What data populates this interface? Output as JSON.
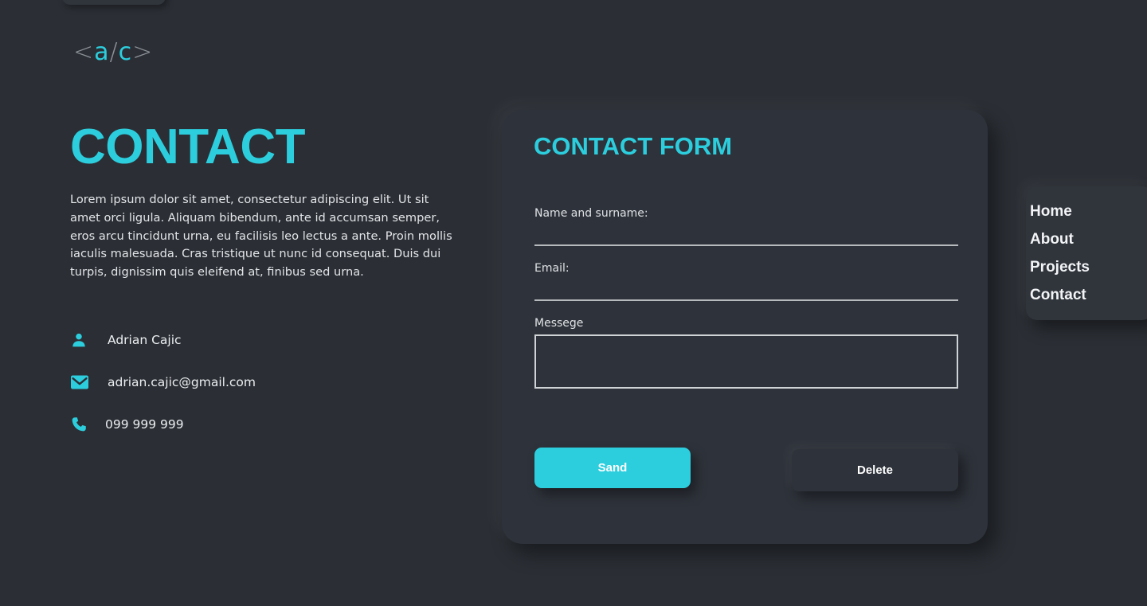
{
  "theme": {
    "background": "#2b2f35",
    "surface": "#2e323a",
    "accent": "#2ccede",
    "text": "#eceef0",
    "muted": "#8c9197"
  },
  "logo": {
    "open_bracket": "<",
    "letter_a": "a",
    "slash": "/",
    "letter_c": "c",
    "close_bracket": ">"
  },
  "left": {
    "title": "CONTACT",
    "intro": "Lorem ipsum dolor sit amet, consectetur adipiscing elit. Ut sit amet orci ligula. Aliquam bibendum, ante id accumsan semper, eros arcu tincidunt urna, eu facilisis leo lectus a ante. Proin mollis iaculis malesuada. Cras tristique ut nunc id consequat. Duis dui turpis, dignissim quis eleifend at, finibus sed urna.",
    "contacts": [
      {
        "icon": "person-icon",
        "value": "Adrian Cajic"
      },
      {
        "icon": "envelope-icon",
        "value": "adrian.cajic@gmail.com"
      },
      {
        "icon": "phone-icon",
        "value": "099 999 999"
      }
    ]
  },
  "form": {
    "title": "CONTACT FORM",
    "fields": [
      {
        "label": "Name and surname:",
        "value": "",
        "placeholder": "",
        "type": "line"
      },
      {
        "label": "Email:",
        "value": "",
        "placeholder": "",
        "type": "line"
      },
      {
        "label": "Messege",
        "value": "",
        "placeholder": "",
        "type": "box"
      }
    ],
    "submit_label": "Sand",
    "delete_label": "Delete"
  },
  "nav": {
    "items": [
      {
        "label": "Home"
      },
      {
        "label": "About"
      },
      {
        "label": "Projects"
      },
      {
        "label": "Contact"
      }
    ]
  }
}
